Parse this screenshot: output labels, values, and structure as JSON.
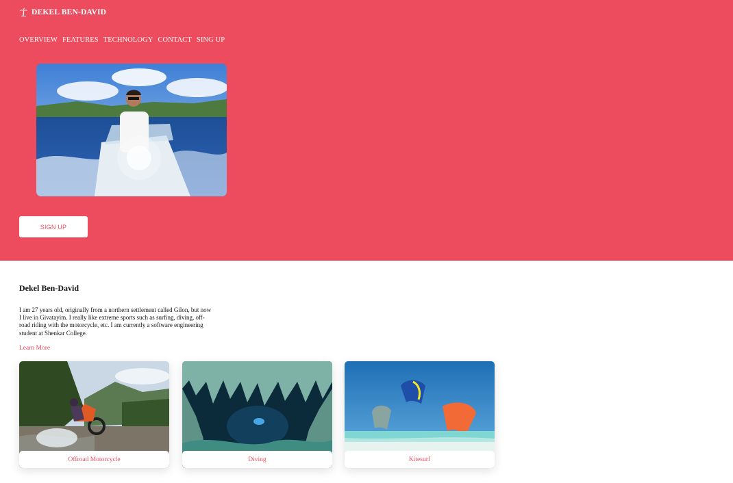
{
  "brand": {
    "name": "DEKEL BEN-DAVID",
    "icon": "palm-tree-icon"
  },
  "nav": {
    "items": [
      {
        "label": "OVERVIEW"
      },
      {
        "label": "FEATURES"
      },
      {
        "label": "TECHNOLOGY"
      },
      {
        "label": "CONTACT"
      },
      {
        "label": "SING UP"
      }
    ]
  },
  "hero": {
    "signup_label": "SIGN UP"
  },
  "about": {
    "title": "Dekel Ben-David",
    "text": "I am 27 years old, originally from a northern settlement called Gilon, but now I live in Givatayim. I really like extreme sports such as surfing, diving, off-road riding with the motorcycle, etc. I am currently a software engineering student at Shenkar College.",
    "learn_more": "Learn More"
  },
  "cards": [
    {
      "label": "Offroad Motorcycle"
    },
    {
      "label": "Diving"
    },
    {
      "label": "Kitesurf"
    }
  ],
  "colors": {
    "accent": "#ec4c5d",
    "background": "#ffffff"
  }
}
